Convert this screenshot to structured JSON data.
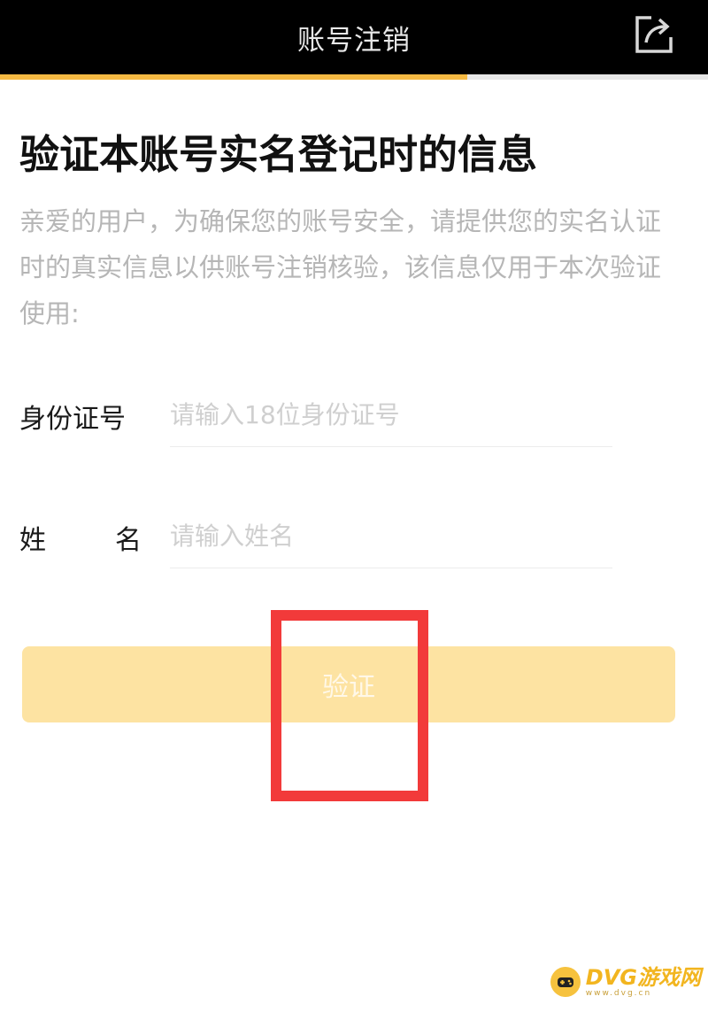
{
  "header": {
    "title": "账号注销",
    "share_icon": "share-export-icon",
    "progress_fraction": 0.66
  },
  "main": {
    "heading": "验证本账号实名登记时的信息",
    "description": "亲爱的用户，为确保您的账号安全，请提供您的实名认证时的真实信息以供账号注销核验，该信息仅用于本次验证使用:",
    "id_field": {
      "label": "身份证号",
      "placeholder": "请输入18位身份证号",
      "value": ""
    },
    "name_field": {
      "label_first": "姓",
      "label_second": "名",
      "placeholder": "请输入姓名",
      "value": ""
    },
    "verify_button": {
      "label": "验证"
    }
  },
  "watermark": {
    "text": "DVG游戏网",
    "subtext": "www.dvg.cn"
  },
  "colors": {
    "accent": "#f5b942",
    "button_disabled": "#fde3a2",
    "highlight": "#f23a3a"
  }
}
